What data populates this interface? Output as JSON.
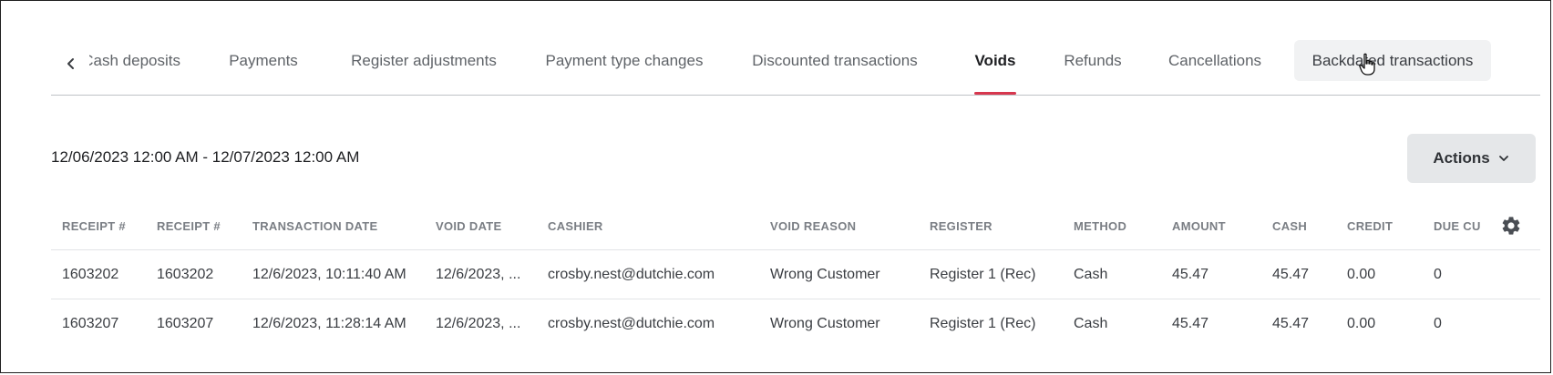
{
  "tabs": {
    "items": [
      {
        "label": "Cash deposits"
      },
      {
        "label": "Payments"
      },
      {
        "label": "Register adjustments"
      },
      {
        "label": "Payment type changes"
      },
      {
        "label": "Discounted transactions"
      },
      {
        "label": "Voids"
      },
      {
        "label": "Refunds"
      },
      {
        "label": "Cancellations"
      },
      {
        "label": "Backdated transactions"
      }
    ],
    "active": "Voids",
    "hovered": "Backdated transactions"
  },
  "date_range": "12/06/2023 12:00 AM - 12/07/2023 12:00 AM",
  "actions": {
    "label": "Actions"
  },
  "table": {
    "columns": [
      "RECEIPT #",
      "RECEIPT #",
      "TRANSACTION DATE",
      "VOID DATE",
      "CASHIER",
      "VOID REASON",
      "REGISTER",
      "METHOD",
      "AMOUNT",
      "CASH",
      "CREDIT",
      "DUE CU"
    ],
    "rows": [
      [
        "1603202",
        "1603202",
        "12/6/2023, 10:11:40 AM",
        "12/6/2023, ...",
        "crosby.nest@dutchie.com",
        "Wrong Customer",
        "Register 1 (Rec)",
        "Cash",
        "45.47",
        "45.47",
        "0.00",
        "0"
      ],
      [
        "1603207",
        "1603207",
        "12/6/2023, 11:28:14 AM",
        "12/6/2023, ...",
        "crosby.nest@dutchie.com",
        "Wrong Customer",
        "Register 1 (Rec)",
        "Cash",
        "45.47",
        "45.47",
        "0.00",
        "0"
      ]
    ]
  },
  "icons": {
    "tab_prev": "chevron-left-icon",
    "tab_next": "chevron-right-icon",
    "actions_caret": "chevron-down-icon",
    "column_settings": "gear-icon",
    "cursor": "hand-pointer-icon"
  },
  "colors": {
    "active_tab_underline": "#d7374e",
    "actions_bg": "#e5e7e9",
    "hover_tab_bg": "#f1f2f3"
  }
}
